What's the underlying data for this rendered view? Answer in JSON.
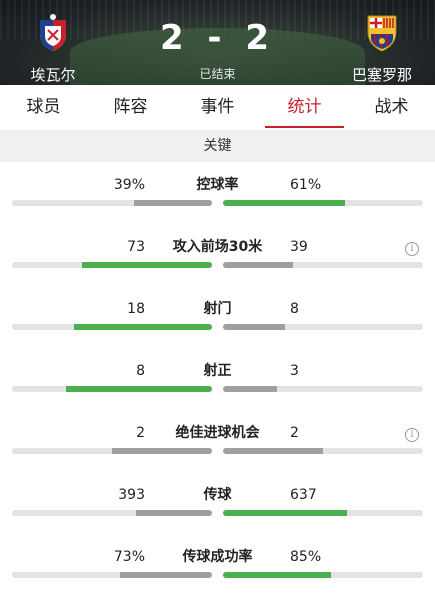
{
  "match": {
    "home_team": "埃瓦尔",
    "away_team": "巴塞罗那",
    "score": "2 - 2",
    "status": "已结束",
    "home_crest_icon": "eibar-crest-icon",
    "away_crest_icon": "barcelona-crest-icon"
  },
  "tabs": [
    {
      "label": "球员",
      "active": false
    },
    {
      "label": "阵容",
      "active": false
    },
    {
      "label": "事件",
      "active": false
    },
    {
      "label": "统计",
      "active": true
    },
    {
      "label": "战术",
      "active": false
    }
  ],
  "section_title": "关键",
  "colors": {
    "accent": "#c8202a",
    "leader": "#4caf50",
    "trailer": "#9e9ea3"
  },
  "stats": [
    {
      "label": "控球率",
      "home": "39%",
      "away": "61%",
      "home_fraction": 0.39,
      "away_fraction": 0.61,
      "info": false
    },
    {
      "label": "攻入前场30米",
      "home": "73",
      "away": "39",
      "home_fraction": 0.65,
      "away_fraction": 0.35,
      "info": true
    },
    {
      "label": "射门",
      "home": "18",
      "away": "8",
      "home_fraction": 0.69,
      "away_fraction": 0.31,
      "info": false
    },
    {
      "label": "射正",
      "home": "8",
      "away": "3",
      "home_fraction": 0.73,
      "away_fraction": 0.27,
      "info": false
    },
    {
      "label": "绝佳进球机会",
      "home": "2",
      "away": "2",
      "home_fraction": 0.5,
      "away_fraction": 0.5,
      "info": true
    },
    {
      "label": "传球",
      "home": "393",
      "away": "637",
      "home_fraction": 0.38,
      "away_fraction": 0.62,
      "info": false
    },
    {
      "label": "传球成功率",
      "home": "73%",
      "away": "85%",
      "home_fraction": 0.46,
      "away_fraction": 0.54,
      "info": false
    }
  ]
}
